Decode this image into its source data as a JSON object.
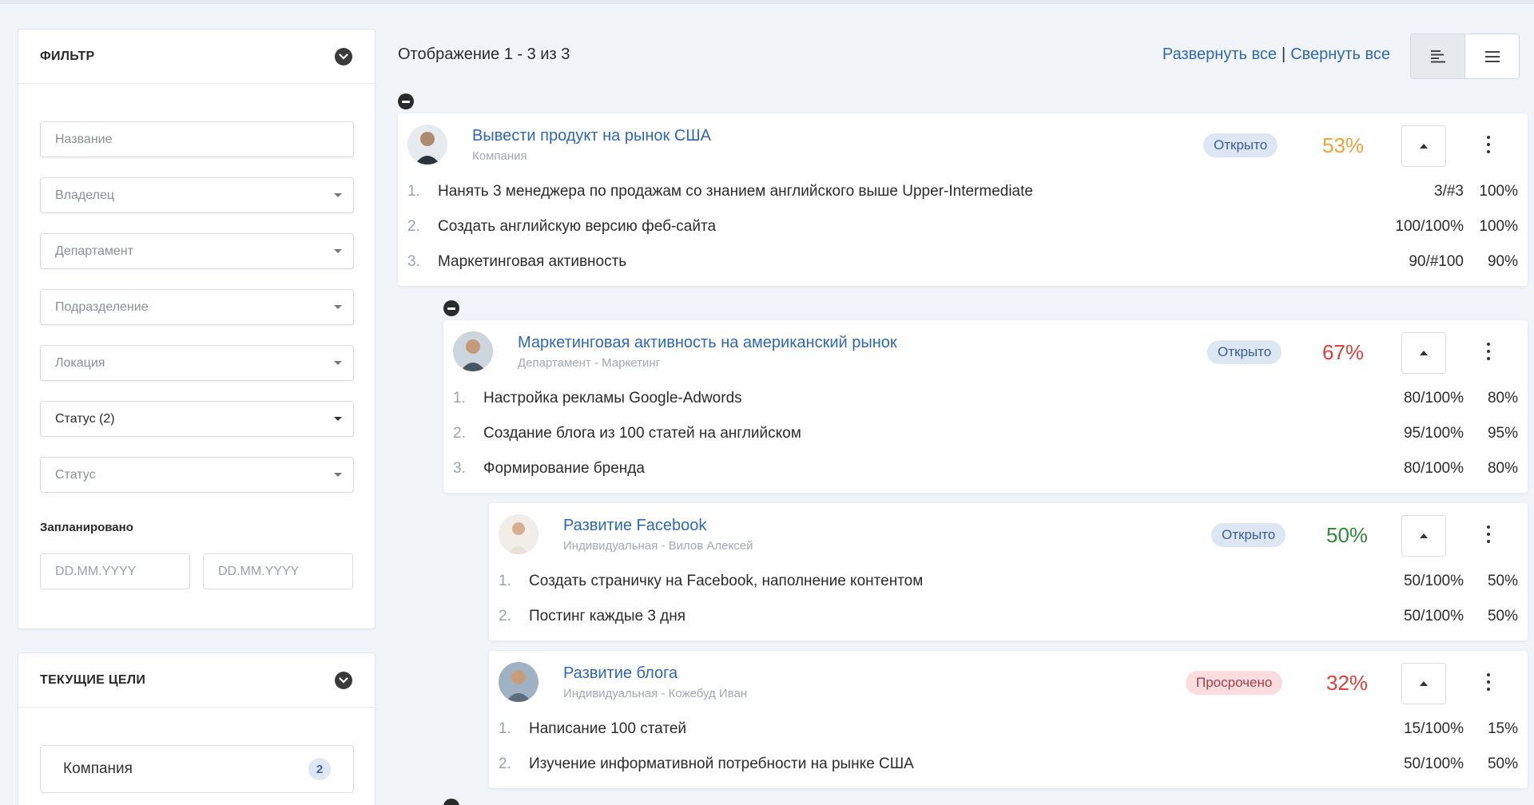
{
  "filter": {
    "title": "ФИЛЬТР",
    "name_placeholder": "Название",
    "owner": "Владелец",
    "department": "Департамент",
    "subdivision": "Подразделение",
    "location": "Локация",
    "status_selected": "Статус (2)",
    "status": "Статус",
    "planned_label": "Запланировано",
    "date_from_placeholder": "DD.MM.YYYY",
    "date_to_placeholder": "DD.MM.YYYY"
  },
  "current_goals": {
    "title": "ТЕКУЩИЕ ЦЕЛИ",
    "items": [
      {
        "label": "Компания",
        "count": "2"
      }
    ]
  },
  "main": {
    "showing": "Отображение 1 - 3 из 3",
    "expand_all": "Развернуть все",
    "separator": "|",
    "collapse_all": "Свернуть все"
  },
  "goals": [
    {
      "title": "Вывести продукт на рынок США",
      "subtitle": "Компания",
      "status": "Открыто",
      "percent": "53%",
      "percent_color": "#f0a23b",
      "key_results": [
        {
          "num": "1.",
          "text": "Нанять 3 менеджера по продажам со знанием английского выше Upper-Intermediate",
          "value": "3/#3",
          "pct": "100%"
        },
        {
          "num": "2.",
          "text": "Создать английскую версию феб-сайта",
          "value": "100/100%",
          "pct": "100%"
        },
        {
          "num": "3.",
          "text": "Маркетинговая активность",
          "value": "90/#100",
          "pct": "90%"
        }
      ]
    },
    {
      "title": "Маркетинговая активность на американский рынок",
      "subtitle": "Департамент - Маркетинг",
      "status": "Открыто",
      "percent": "67%",
      "percent_color": "#e0403b",
      "key_results": [
        {
          "num": "1.",
          "text": "Настройка рекламы Google-Adwords",
          "value": "80/100%",
          "pct": "80%"
        },
        {
          "num": "2.",
          "text": "Создание блога из 100 статей на английском",
          "value": "95/100%",
          "pct": "95%"
        },
        {
          "num": "3.",
          "text": "Формирование бренда",
          "value": "80/100%",
          "pct": "80%"
        }
      ]
    },
    {
      "title": "Развитие Facebook",
      "subtitle": "Индивидуальная - Вилов Алексей",
      "status": "Открыто",
      "percent": "50%",
      "percent_color": "#2f8a3d",
      "key_results": [
        {
          "num": "1.",
          "text": "Создать страничку на Facebook, наполнение контентом",
          "value": "50/100%",
          "pct": "50%"
        },
        {
          "num": "2.",
          "text": "Постинг каждые 3 дня",
          "value": "50/100%",
          "pct": "50%"
        }
      ]
    },
    {
      "title": "Развитие блога",
      "subtitle": "Индивидуальная - Кожебуд Иван",
      "status": "Просрочено",
      "percent": "32%",
      "percent_color": "#e0403b",
      "key_results": [
        {
          "num": "1.",
          "text": "Написание 100 статей",
          "value": "15/100%",
          "pct": "15%"
        },
        {
          "num": "2.",
          "text": "Изучение информативной потребности на рынке США",
          "value": "50/100%",
          "pct": "50%"
        }
      ]
    }
  ]
}
